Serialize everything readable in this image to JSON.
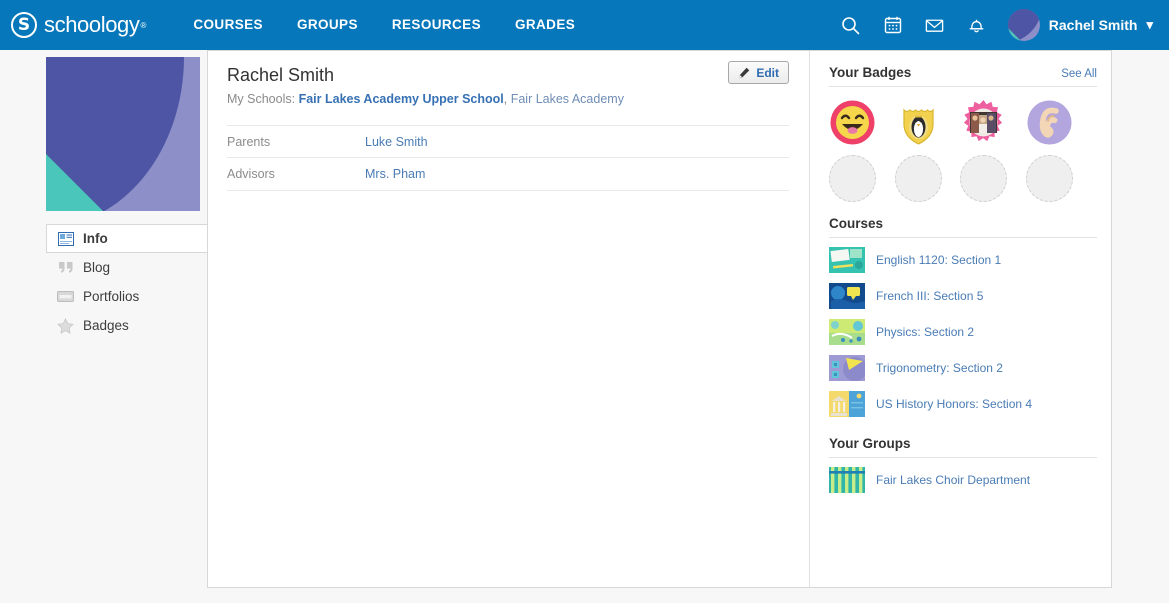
{
  "brand": {
    "logo_text": "schoology",
    "logo_mark": "S",
    "accent_color": "#0677ba",
    "link_color": "#4a7cb5"
  },
  "topnav": {
    "items": [
      {
        "label": "COURSES",
        "name": "nav-courses"
      },
      {
        "label": "GROUPS",
        "name": "nav-groups"
      },
      {
        "label": "RESOURCES",
        "name": "nav-resources"
      },
      {
        "label": "GRADES",
        "name": "nav-grades"
      }
    ],
    "icons": [
      "search-icon",
      "calendar-icon",
      "mail-icon",
      "notifications-bell-icon"
    ],
    "user_name": "Rachel Smith",
    "chevron": "⌄"
  },
  "sidebar": {
    "items": [
      {
        "label": "Info",
        "icon": "info-card-icon",
        "active": true
      },
      {
        "label": "Blog",
        "icon": "quote-icon",
        "active": false
      },
      {
        "label": "Portfolios",
        "icon": "portfolio-box-icon",
        "active": false
      },
      {
        "label": "Badges",
        "icon": "star-icon",
        "active": false
      }
    ]
  },
  "profile": {
    "name": "Rachel Smith",
    "schools_label": "My Schools:",
    "school_primary": "Fair Lakes Academy Upper School",
    "school_separator": ", ",
    "school_secondary": "Fair Lakes Academy",
    "edit_label": "Edit"
  },
  "info_fields": [
    {
      "label": "Parents",
      "value": "Luke Smith"
    },
    {
      "label": "Advisors",
      "value": "Mrs. Pham"
    }
  ],
  "badges": {
    "title": "Your Badges",
    "see_all": "See All",
    "earned": [
      {
        "name": "smiley-face-badge",
        "colors": [
          "#ef4069",
          "#f6d64a"
        ]
      },
      {
        "name": "penguin-shield-badge",
        "colors": [
          "#f2d14e",
          "#e8bc2e"
        ]
      },
      {
        "name": "group-photo-starburst-badge",
        "colors": [
          "#ee5fa0",
          "#f3f1ee"
        ]
      },
      {
        "name": "ear-badge",
        "colors": [
          "#b3a5dd",
          "#f3d6b6"
        ]
      }
    ],
    "empty_count": 4
  },
  "courses": {
    "title": "Courses",
    "items": [
      {
        "label": "English 1120: Section 1",
        "thumb": [
          "#2fbfb0",
          "#7fd8c6"
        ]
      },
      {
        "label": "French III: Section 5",
        "thumb": [
          "#144a8c",
          "#2a77c4"
        ]
      },
      {
        "label": "Physics: Section 2",
        "thumb": [
          "#c6e86b",
          "#8fd3cf"
        ]
      },
      {
        "label": "Trigonometry: Section 2",
        "thumb": [
          "#9e9ad4",
          "#5fc6d8"
        ]
      },
      {
        "label": "US History Honors: Section 4",
        "thumb": [
          "#f2d35c",
          "#4ba3d8"
        ]
      }
    ]
  },
  "groups": {
    "title": "Your Groups",
    "items": [
      {
        "label": "Fair Lakes Choir Department",
        "thumb": [
          "#2fb6a8",
          "#c9ec8a"
        ]
      }
    ]
  }
}
